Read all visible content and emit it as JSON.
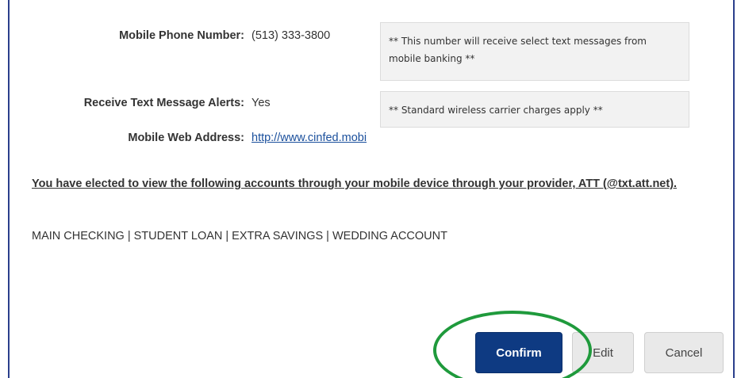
{
  "mobile_phone": {
    "label": "Mobile Phone Number:",
    "value": "(513) 333-3800",
    "note": "** This number will receive select text messages from mobile banking **"
  },
  "text_alerts": {
    "label": "Receive Text Message Alerts:",
    "value": "Yes",
    "note": "** Standard wireless carrier charges apply **"
  },
  "mobile_web": {
    "label": "Mobile Web Address:",
    "value": "http://www.cinfed.mobi"
  },
  "elected_message": "You have elected to view the following accounts through your mobile device through your provider, ATT (@txt.att.net).",
  "accounts_list": "MAIN CHECKING | STUDENT LOAN | EXTRA SAVINGS | WEDDING ACCOUNT",
  "buttons": {
    "confirm": "Confirm",
    "edit": "Edit",
    "cancel": "Cancel"
  },
  "colors": {
    "primary_button": "#0e3a82",
    "secondary_button": "#e9e9e9",
    "link": "#1a4f9c",
    "highlight_circle": "#1f9a3c",
    "frame_border": "#2b3f8c"
  }
}
